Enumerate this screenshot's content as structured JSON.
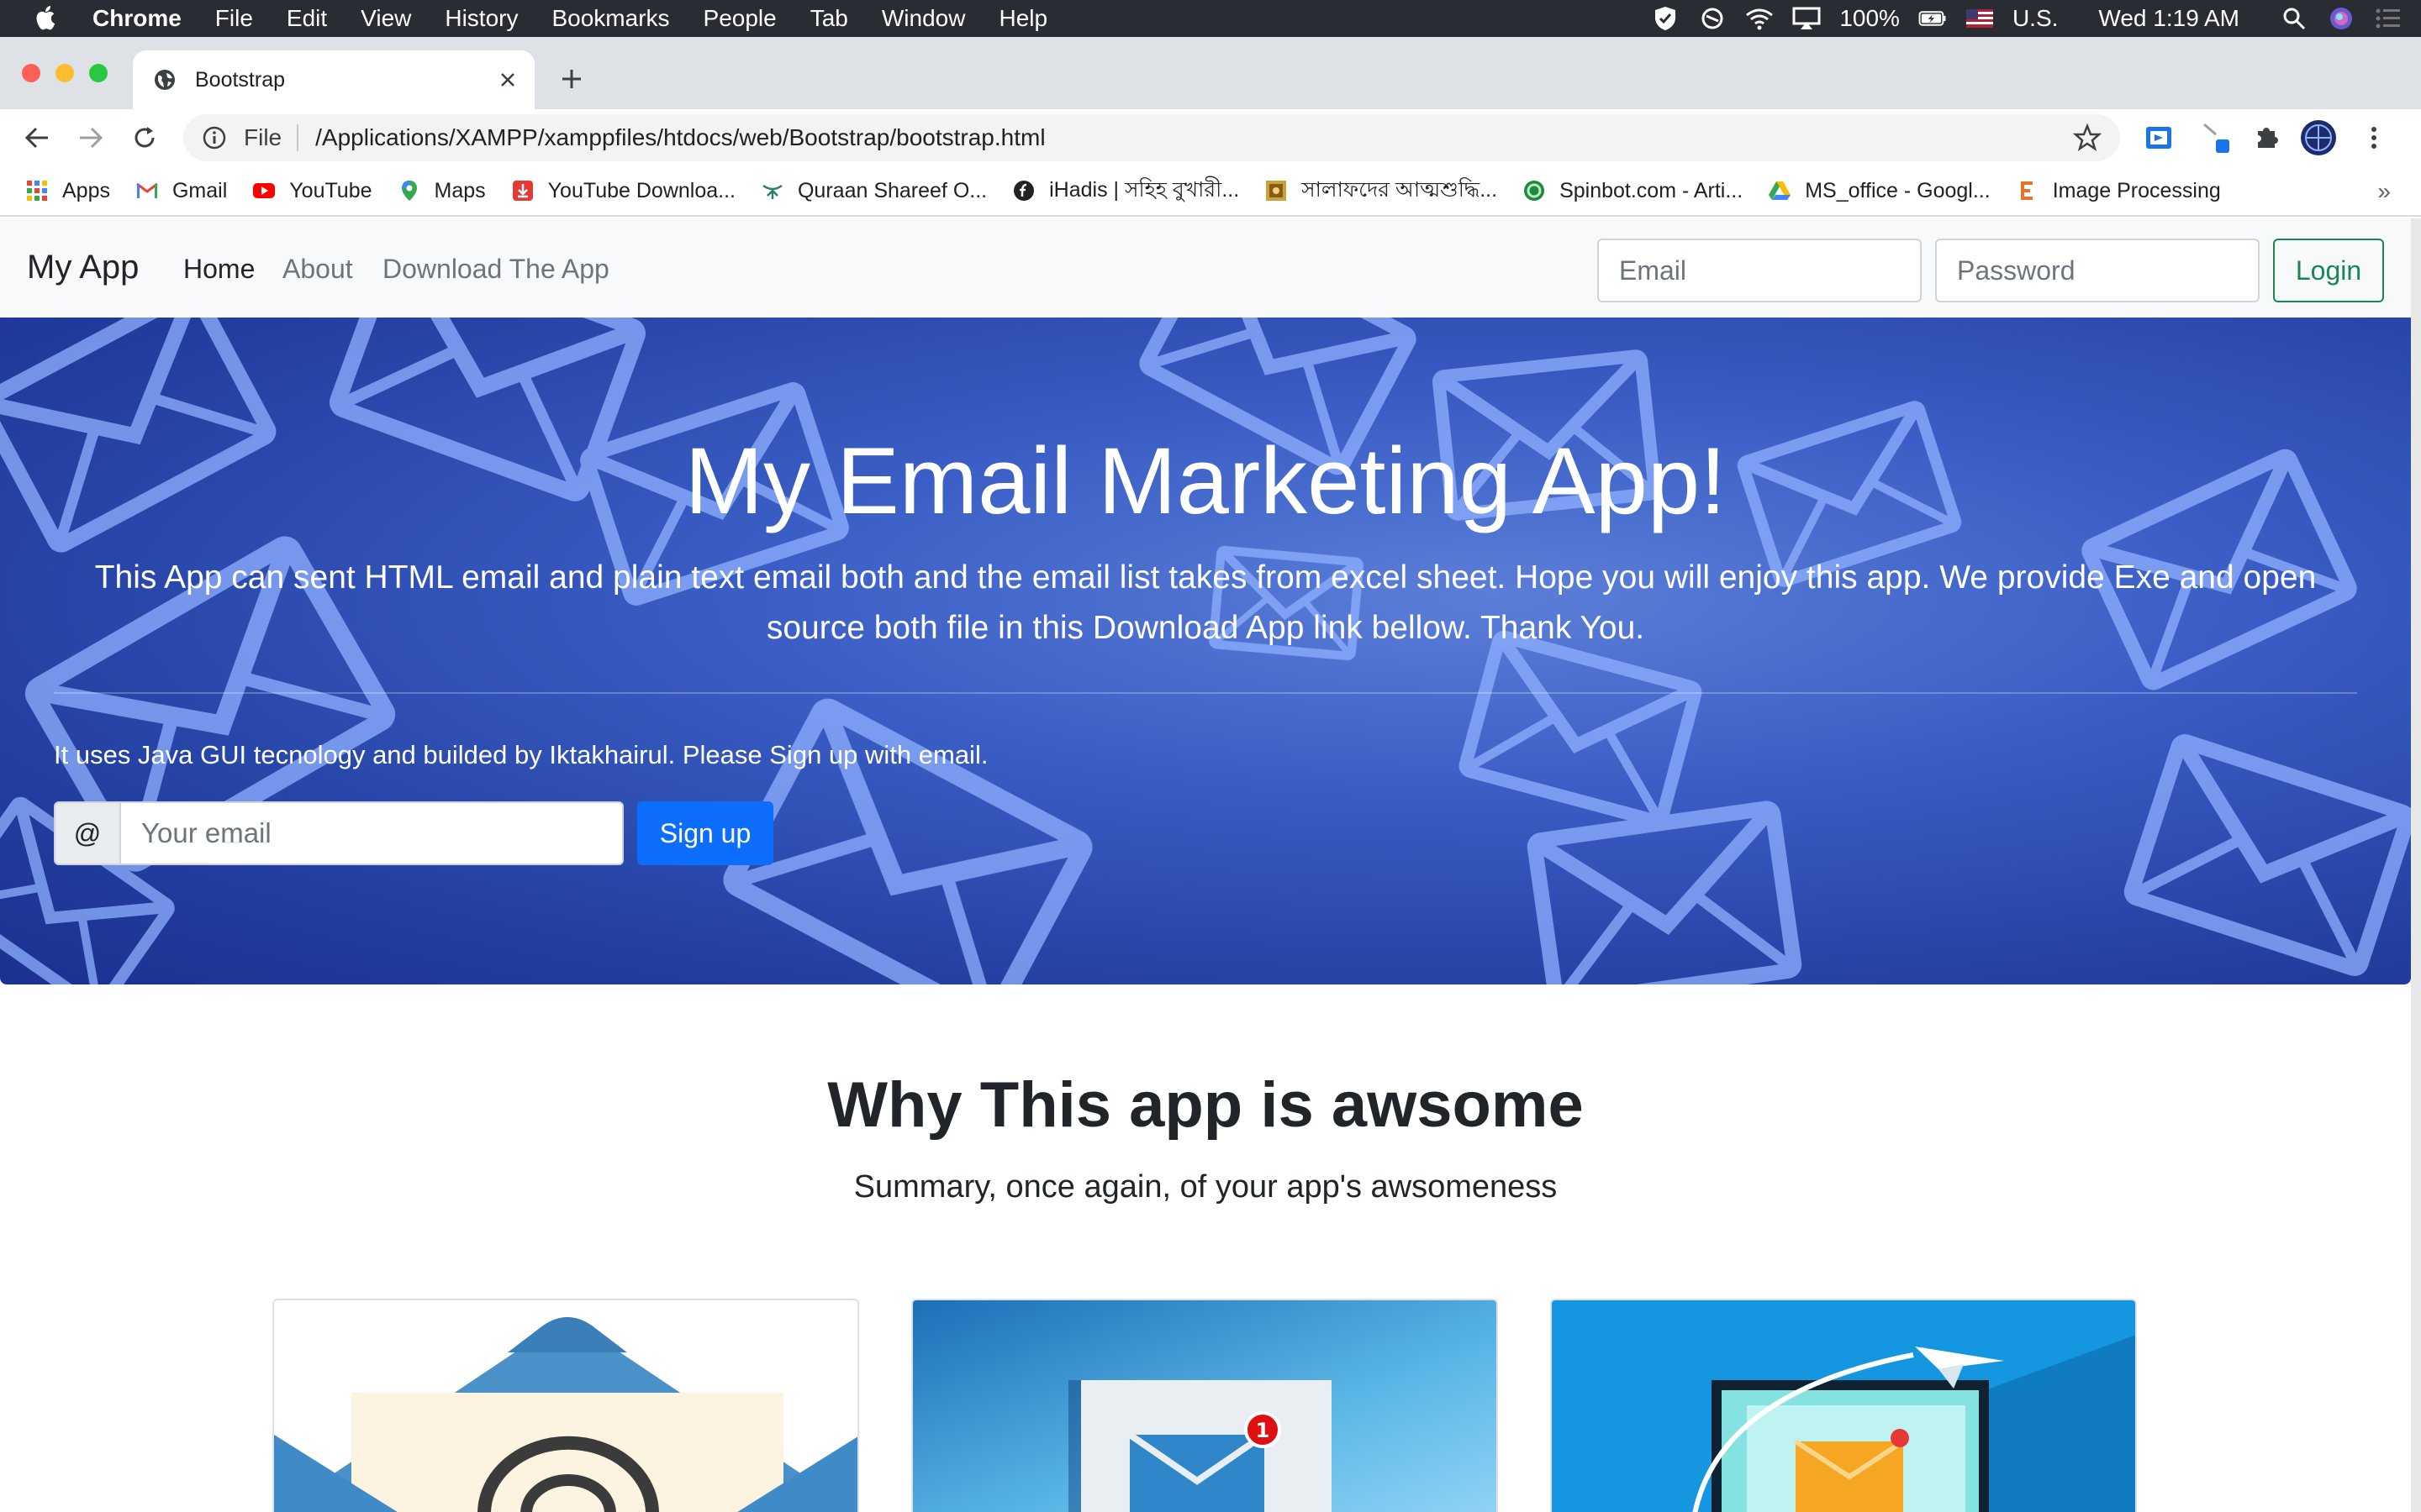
{
  "menubar": {
    "items": [
      "Chrome",
      "File",
      "Edit",
      "View",
      "History",
      "Bookmarks",
      "People",
      "Tab",
      "Window",
      "Help"
    ],
    "battery": "100%",
    "input_source": "U.S.",
    "clock": "Wed 1:19 AM"
  },
  "browser": {
    "tab_title": "Bootstrap",
    "scheme_label": "File",
    "url": "/Applications/XAMPP/xamppfiles/htdocs/web/Bootstrap/bootstrap.html",
    "bookmarks": [
      "Apps",
      "Gmail",
      "YouTube",
      "Maps",
      "YouTube Downloa...",
      "Quraan Shareef O...",
      "iHadis | সহিহ বুখারী...",
      "সালাফদের আত্মশুদ্ধি...",
      "Spinbot.com - Arti...",
      "MS_office - Googl...",
      "Image Processing"
    ],
    "bookmarks_overflow": "»"
  },
  "navbar": {
    "brand": "My App",
    "links": [
      "Home",
      "About",
      "Download The App"
    ],
    "email_placeholder": "Email",
    "password_placeholder": "Password",
    "login_label": "Login"
  },
  "hero": {
    "title": "My Email Marketing App!",
    "lead": "This App can sent HTML email and plain text email both and the email list takes from excel sheet. Hope you will enjoy this app. We provide Exe and open source both file in this Download App link bellow. Thank You.",
    "subtext": "It uses Java GUI tecnology and builded by Iktakhairul. Please Sign up with email.",
    "input_prefix": "@",
    "email_placeholder": "Your email",
    "signup_label": "Sign up"
  },
  "features": {
    "title": "Why This app is awsome",
    "subtitle": "Summary, once again, of your app's awsomeness",
    "badge": "1"
  },
  "colors": {
    "primary": "#0d6efd",
    "success": "#198754",
    "hero_blue": "#2c4bb3"
  }
}
